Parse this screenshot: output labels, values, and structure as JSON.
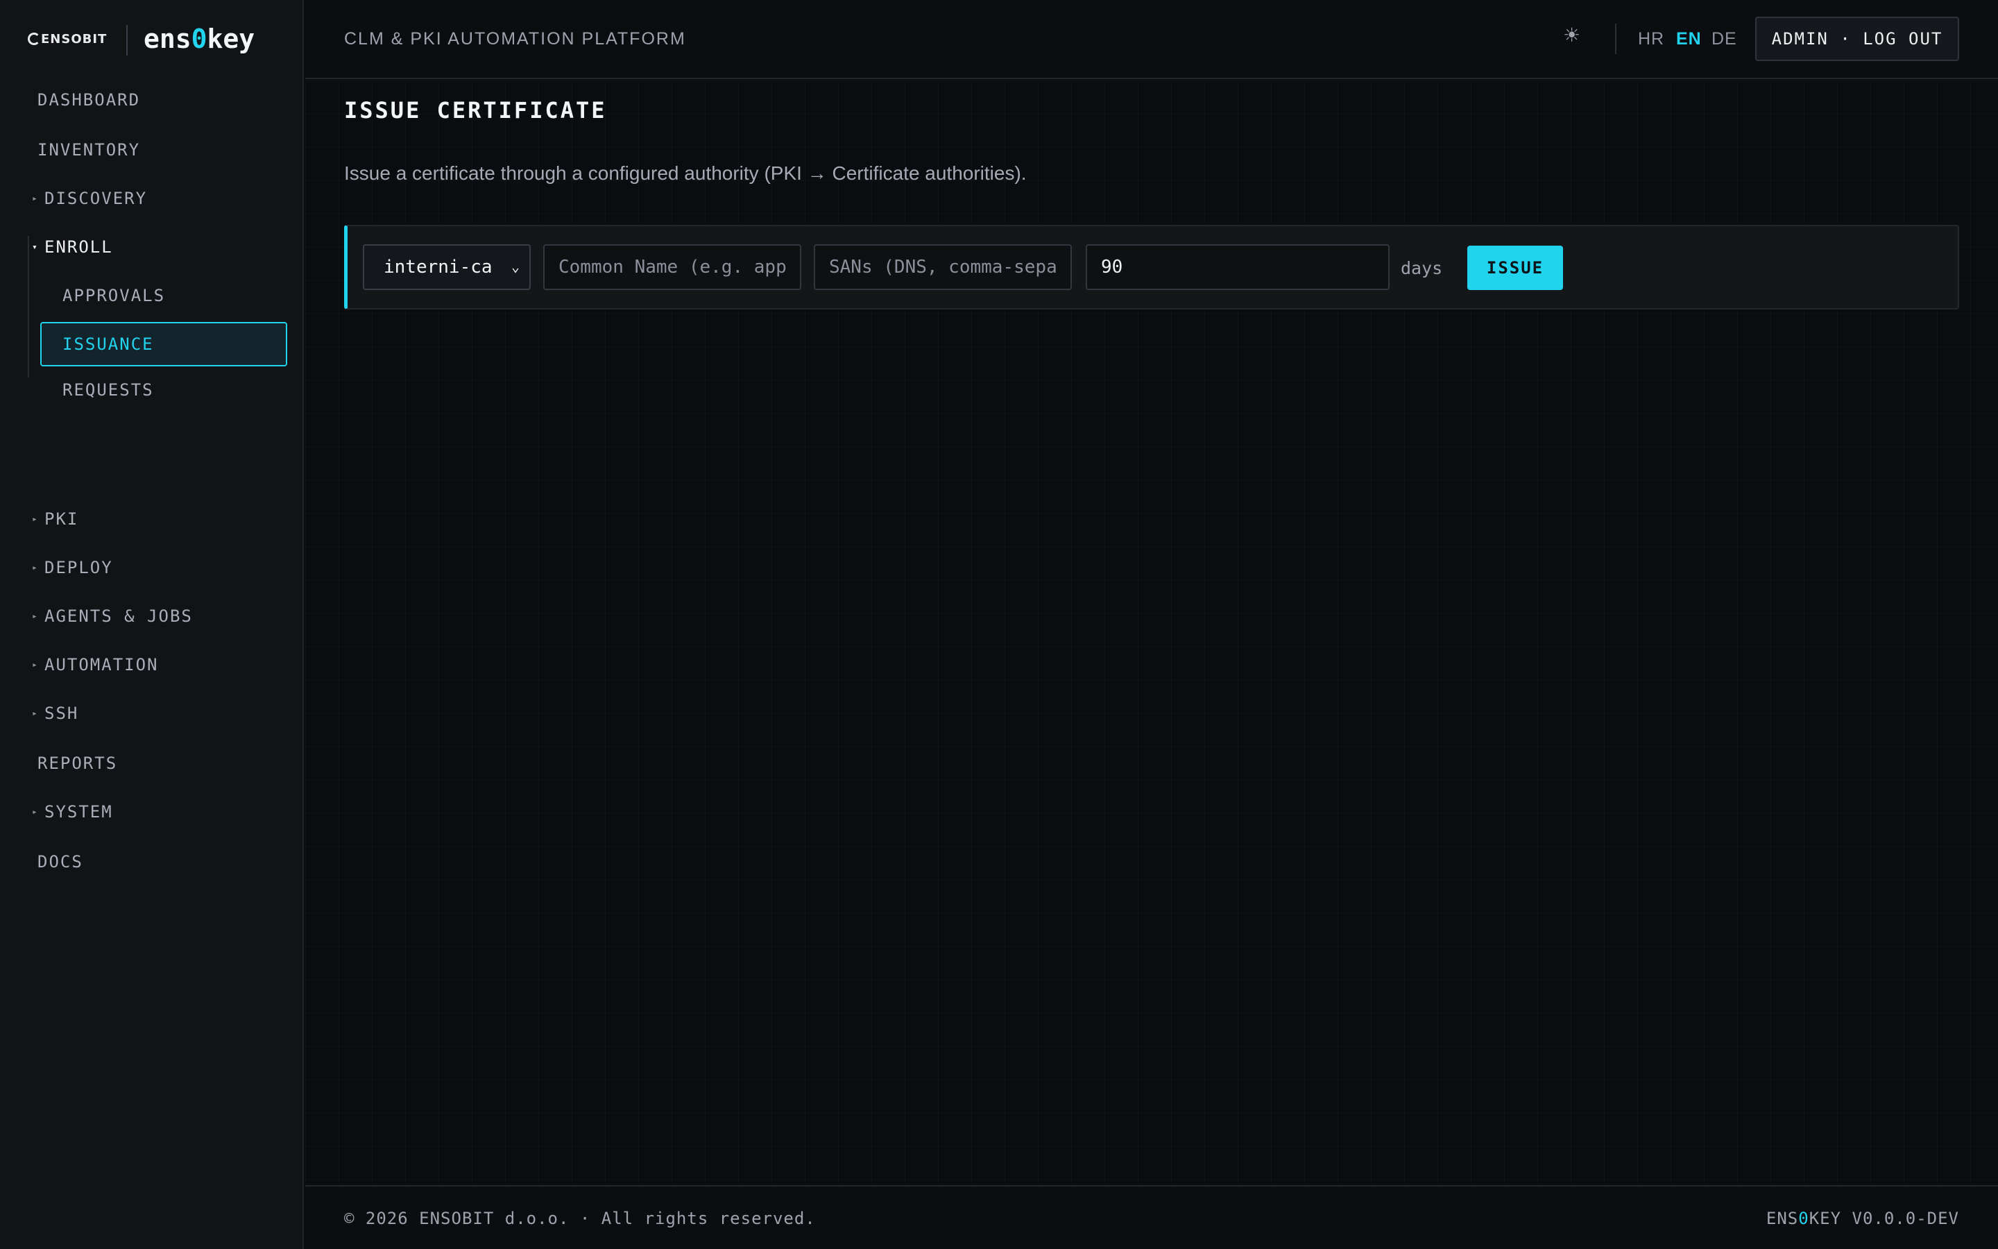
{
  "brand": {
    "company_logo": "ENSOBIT",
    "product_prefix": "ens",
    "product_zero": "0",
    "product_suffix": "key"
  },
  "header": {
    "platform_label": "CLM & PKI AUTOMATION PLATFORM",
    "theme_icon": "sun-icon",
    "languages": [
      "HR",
      "EN",
      "DE"
    ],
    "active_language": "EN",
    "logout_label": "ADMIN · LOG OUT"
  },
  "sidebar": {
    "items": [
      {
        "label": "DASHBOARD",
        "expandable": false
      },
      {
        "label": "INVENTORY",
        "expandable": false
      },
      {
        "label": "DISCOVERY",
        "expandable": true,
        "caret": "▸"
      },
      {
        "label": "ENROLL",
        "expandable": true,
        "caret": "▾",
        "open": true
      },
      {
        "label": "PKI",
        "expandable": true,
        "caret": "▸"
      },
      {
        "label": "DEPLOY",
        "expandable": true,
        "caret": "▸"
      },
      {
        "label": "AGENTS & JOBS",
        "expandable": true,
        "caret": "▸"
      },
      {
        "label": "AUTOMATION",
        "expandable": true,
        "caret": "▸"
      },
      {
        "label": "SSH",
        "expandable": true,
        "caret": "▸"
      },
      {
        "label": "REPORTS",
        "expandable": false
      },
      {
        "label": "SYSTEM",
        "expandable": true,
        "caret": "▸"
      },
      {
        "label": "DOCS",
        "expandable": false
      }
    ],
    "enroll_sub": [
      {
        "label": "APPROVALS"
      },
      {
        "label": "ISSUANCE",
        "active": true
      },
      {
        "label": "REQUESTS"
      }
    ]
  },
  "main": {
    "title": "ISSUE CERTIFICATE",
    "description": "Issue a certificate through a configured authority (PKI → Certificate authorities).",
    "form": {
      "ca_select_value": "interni-ca",
      "common_name_placeholder": "Common Name (e.g. app",
      "sans_placeholder": "SANs (DNS, comma-sepa",
      "validity_value": "90",
      "days_label": "days",
      "issue_label": "ISSUE"
    }
  },
  "footer": {
    "copyright": "© 2026 ENSOBIT d.o.o. · All rights reserved.",
    "version_prefix": "ENS",
    "version_zero": "0",
    "version_suffix": "KEY V0.0.0-DEV"
  },
  "colors": {
    "accent": "#22d3ee",
    "background": "#0b0c0f",
    "sidebar": "#121317"
  }
}
